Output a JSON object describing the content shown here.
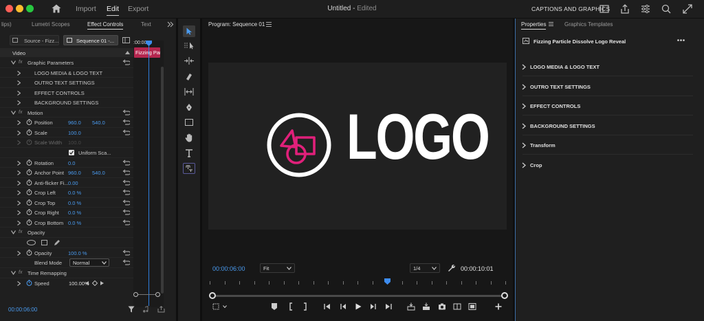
{
  "topbar": {
    "nav": [
      "Import",
      "Edit",
      "Export"
    ],
    "doc_title": "Untitled",
    "doc_status": "Edited",
    "captions_label": "CAPTIONS AND GRAPHICS"
  },
  "left_panel": {
    "tabs": [
      "lips)",
      "Lumetri Scopes",
      "Effect Controls",
      "Text"
    ],
    "source_tab": "Source - Fizz...",
    "sequence_tab": "Sequence 01 -...",
    "mini_timecode": ":00:00",
    "clip_label": "Fizzing Par",
    "video_header": "Video",
    "rows": {
      "graphic_parameters": "Graphic Parameters",
      "logo_media": "LOGO MEDIA & LOGO TEXT",
      "outro_text": "OUTRO TEXT SETTINGS",
      "effect_controls": "EFFECT CONTROLS",
      "background_settings": "BACKGROUND SETTINGS",
      "motion": "Motion",
      "position": {
        "label": "Position",
        "x": "960.0",
        "y": "540.0"
      },
      "scale": {
        "label": "Scale",
        "value": "100.0"
      },
      "scale_width": {
        "label": "Scale Width",
        "value": "100.0"
      },
      "uniform_scale": "Uniform Sca...",
      "rotation": {
        "label": "Rotation",
        "value": "0.0"
      },
      "anchor_point": {
        "label": "Anchor Point",
        "x": "960.0",
        "y": "540.0"
      },
      "anti_flicker": {
        "label": "Anti-flicker Fi...",
        "value": "0.00"
      },
      "crop_left": {
        "label": "Crop Left",
        "value": "0.0 %"
      },
      "crop_top": {
        "label": "Crop Top",
        "value": "0.0 %"
      },
      "crop_right": {
        "label": "Crop Right",
        "value": "0.0 %"
      },
      "crop_bottom": {
        "label": "Crop Bottom",
        "value": "0.0 %"
      },
      "opacity_group": "Opacity",
      "opacity": {
        "label": "Opacity",
        "value": "100.0 %"
      },
      "blend_mode": {
        "label": "Blend Mode",
        "value": "Normal"
      },
      "time_remapping": "Time Remapping",
      "speed": {
        "label": "Speed",
        "value": "100.00%"
      }
    },
    "timecode": "00:00:06:00"
  },
  "program": {
    "title": "Program: Sequence 01",
    "logo_text": "LOGO",
    "current_timecode": "00:00:06:00",
    "fit_value": "Fit",
    "resolution_value": "1/4",
    "duration_timecode": "00:00:10:01",
    "playhead_fraction": 0.6
  },
  "properties": {
    "tabs": [
      "Properties",
      "Graphics Templates"
    ],
    "item_title": "Fizzing Particle Dissolve Logo Reveal",
    "sections": [
      "LOGO MEDIA & LOGO TEXT",
      "OUTRO TEXT SETTINGS",
      "EFFECT CONTROLS",
      "BACKGROUND SETTINGS",
      "Transform",
      "Crop"
    ]
  },
  "colors": {
    "accent_blue": "#4a9bf0",
    "logo_pink": "#e0207a",
    "clip_pink": "#b5264f"
  }
}
